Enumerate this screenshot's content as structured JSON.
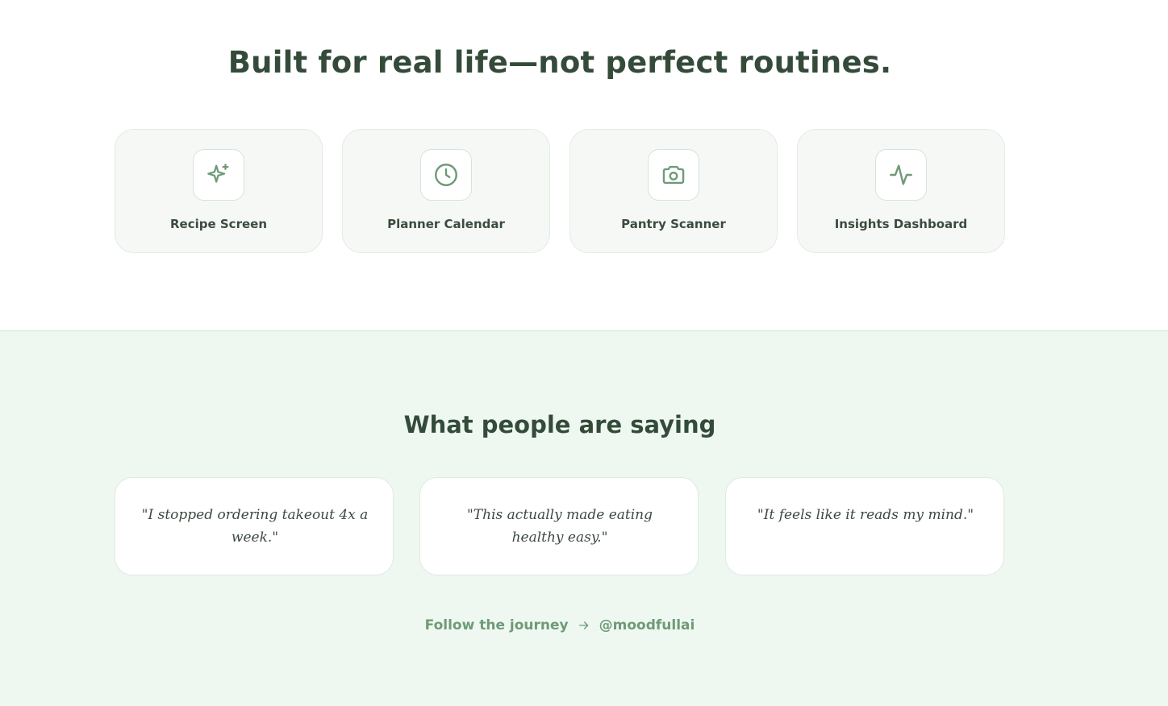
{
  "features": {
    "title": "Built for real life—not perfect routines.",
    "cards": [
      {
        "label": "Recipe Screen",
        "icon": "sparkles-icon"
      },
      {
        "label": "Planner Calendar",
        "icon": "clock-icon"
      },
      {
        "label": "Pantry Scanner",
        "icon": "camera-icon"
      },
      {
        "label": "Insights Dashboard",
        "icon": "activity-icon"
      }
    ]
  },
  "testimonials": {
    "title": "What people are saying",
    "quotes": [
      "\"I stopped ordering takeout 4x a week.\"",
      "\"This actually made eating healthy easy.\"",
      "\"It feels like it reads my mind.\""
    ]
  },
  "follow": {
    "label": "Follow the journey",
    "icon": "arrow-right-icon",
    "handle": "@moodfullai"
  },
  "colors": {
    "accent": "#6f9a78",
    "heading": "#354b3a",
    "section_bg": "#eef8f0"
  }
}
